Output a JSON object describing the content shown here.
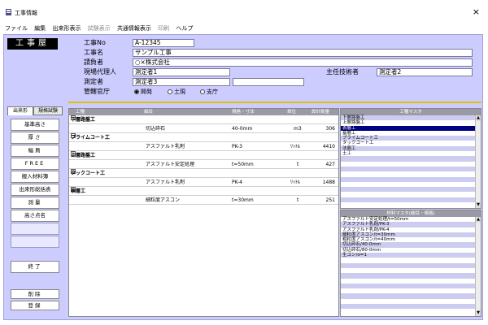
{
  "window": {
    "title": "工事情報",
    "close_glyph": "×"
  },
  "menu": [
    {
      "label": "ファイル",
      "enabled": true
    },
    {
      "label": "編集",
      "enabled": true
    },
    {
      "label": "出来形表示",
      "enabled": true
    },
    {
      "label": "試験表示",
      "enabled": false
    },
    {
      "label": "共通情報表示",
      "enabled": true
    },
    {
      "label": "印刷",
      "enabled": false
    },
    {
      "label": "ヘルプ",
      "enabled": true
    }
  ],
  "app_label": "工事屋",
  "form": {
    "koji_no_label": "工事No",
    "koji_no_value": "A-12345",
    "koji_name_label": "工事名",
    "koji_name_value": "サンプル工事",
    "ukeoi_label": "請負者",
    "ukeoi_value": "○×株式会社",
    "genba_label": "現場代理人",
    "genba_value": "測定者1",
    "shunin_label": "主任技術者",
    "shunin_value": "測定者2",
    "sokutei_label": "測定者",
    "sokutei_value": "測定者3",
    "sokutei_value2": "",
    "kanri_label": "管轄官庁",
    "radio_options": [
      "開発",
      "土現",
      "支庁"
    ],
    "radio_selected": 0
  },
  "side_tabs": [
    "出来形",
    "規格試験"
  ],
  "side_buttons": [
    "基準高さ",
    "厚さ",
    "幅員",
    "FREE",
    "搬入材料簿",
    "出来形総括表",
    "測量",
    "高さ点名"
  ],
  "bottom_buttons": {
    "finish": "終了",
    "delete": "削除",
    "register": "登録"
  },
  "table": {
    "columns": [
      "工種",
      "細目",
      "規格・寸法",
      "単位",
      "設計数量"
    ],
    "rows": [
      {
        "type": "cat",
        "name": "下層路盤工"
      },
      {
        "type": "item",
        "detail": "切込砕石",
        "spec": "40-0mm",
        "unit": "m3",
        "qty": "306"
      },
      {
        "type": "cat",
        "name": "プライムコート工"
      },
      {
        "type": "item",
        "detail": "アスファルト乳剤",
        "spec": "PK-3",
        "unit": "ﾘｯﾄﾙ",
        "qty": "4410"
      },
      {
        "type": "cat",
        "name": "上層路盤工"
      },
      {
        "type": "item",
        "detail": "アスファルト安定処理",
        "spec": "t=50mm",
        "unit": "t",
        "qty": "427"
      },
      {
        "type": "cat",
        "name": "タックコート工"
      },
      {
        "type": "item",
        "detail": "アスファルト乳剤",
        "spec": "PK-4",
        "unit": "ﾘｯﾄﾙ",
        "qty": "1488"
      },
      {
        "type": "cat",
        "name": "表層工"
      },
      {
        "type": "item",
        "detail": "細粒度アスコン",
        "spec": "t=30mm",
        "unit": "t",
        "qty": "251"
      }
    ]
  },
  "right_top": {
    "header": "工種マスタ",
    "items": [
      "下層路盤工",
      "上層路盤工",
      "表層工",
      "基層工",
      "プライムコート工",
      "タックコート工",
      "法面工",
      "土工"
    ],
    "selected": 2
  },
  "right_bottom": {
    "header": "材料マスタ(細目・規格)",
    "items": [
      "アスファルト安定処理/t=50mm",
      "アスファルト乳剤/PK-3",
      "アスファルト乳剤/PK-4",
      "細粒度アスコン/t=30mm",
      "粗粒度アスコン/t=40mm",
      "切込砕石/40-0mm",
      "切込砕石/80-0mm",
      "生コン/σ=1"
    ]
  }
}
